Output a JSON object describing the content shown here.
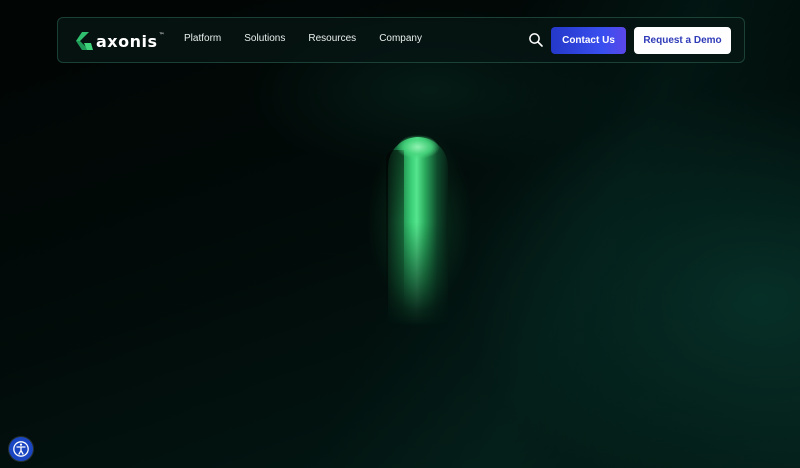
{
  "brand": {
    "name": "axonis",
    "trademark": "™",
    "logo_icon": "axonis-chevron-icon",
    "accent_color": "#3ed37a"
  },
  "nav": {
    "links": [
      "Platform",
      "Solutions",
      "Resources",
      "Company"
    ],
    "search_icon": "search-icon",
    "contact_label": "Contact Us",
    "demo_label": "Request a Demo"
  },
  "colors": {
    "background": "#000000",
    "navbar_border": "#46967d",
    "contact_button": "#3a4ff0",
    "demo_text": "#2f3bb8"
  },
  "accessibility": {
    "icon": "accessibility-settings-icon"
  }
}
